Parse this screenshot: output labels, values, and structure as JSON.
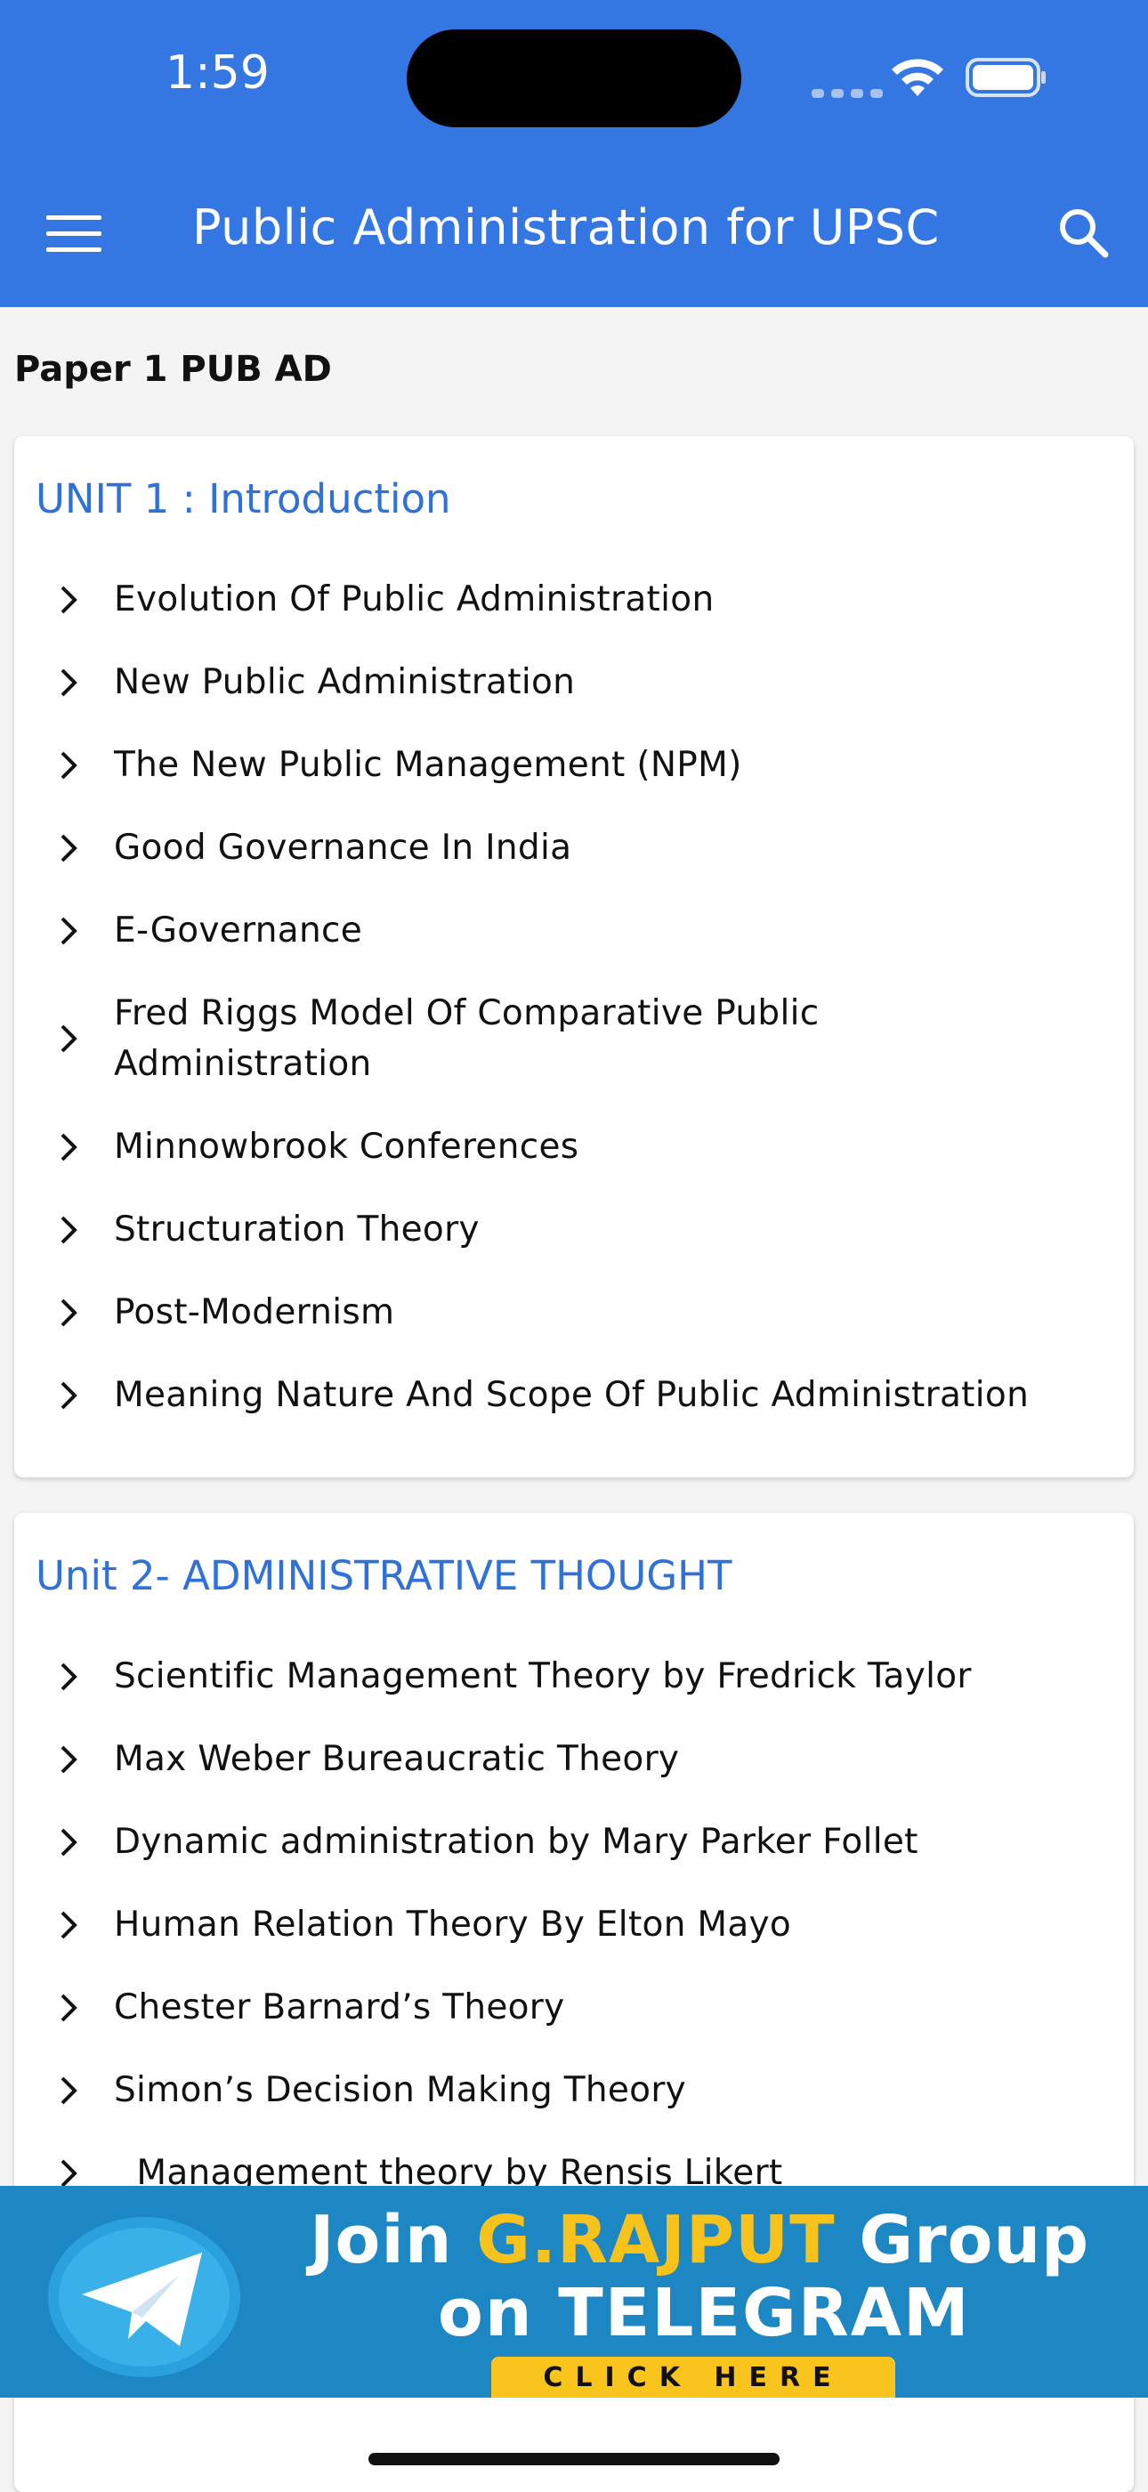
{
  "status_bar": {
    "time": "1:59"
  },
  "app_bar": {
    "title": "Public Administration for UPSC",
    "menu_icon": "menu-icon",
    "search_icon": "search-icon"
  },
  "section_heading": "Paper 1 PUB AD",
  "units": [
    {
      "title": "UNIT 1 : Introduction",
      "items": [
        "Evolution Of Public Administration",
        "New Public Administration",
        "The New Public Management (NPM)",
        "Good Governance In India",
        "E-Governance",
        "Fred Riggs Model Of Comparative Public",
        "Administration",
        "Minnowbrook Conferences",
        "Structuration Theory",
        "Post-Modernism",
        "Meaning Nature And Scope Of Public Administration"
      ]
    },
    {
      "title": "Unit 2- ADMINISTRATIVE THOUGHT",
      "items": [
        "Scientific Management Theory by Fredrick Taylor",
        "Max Weber Bureaucratic Theory",
        "Dynamic administration by Mary Parker Follet",
        "Human Relation Theory By Elton Mayo",
        "Chester Barnard’s Theory",
        "Simon’s Decision Making Theory",
        "  Management theory by Rensis Likert"
      ]
    }
  ],
  "banner": {
    "line1_prefix": "Join ",
    "line1_highlight": "G.RAJPUT",
    "line1_suffix": " Group",
    "line2": "on TELEGRAM",
    "button": "CLICK HERE"
  },
  "colors": {
    "primary": "#3476e2",
    "unit_title": "#2f71d8",
    "banner_bg": "#1c87c2",
    "banner_gold": "#f8c21c"
  }
}
